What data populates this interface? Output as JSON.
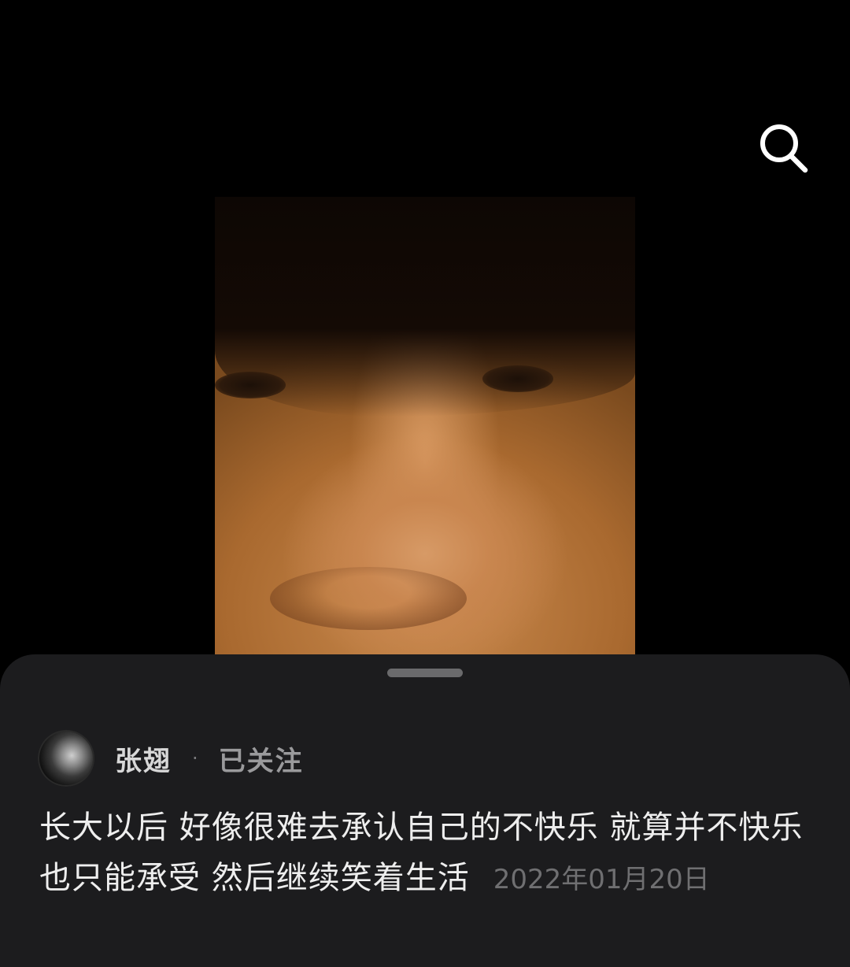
{
  "search": {
    "icon": "search-icon"
  },
  "video": {
    "description_icon": "video-frame"
  },
  "sheet": {
    "author": {
      "name": "张翅",
      "separator": "·",
      "follow_status": "已关注"
    },
    "caption": {
      "text": "长大以后 好像很难去承认自己的不快乐 就算并不快乐 也只能承受 然后继续笑着生活",
      "date": "2022年01月20日"
    }
  }
}
